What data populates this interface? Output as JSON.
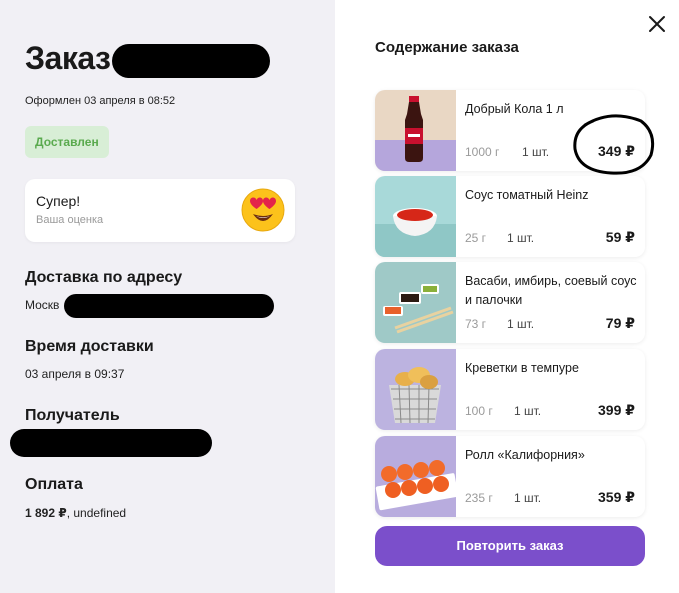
{
  "order": {
    "title": "Заказ",
    "date": "Оформлен 03 апреля в 08:52",
    "status": "Доставлен"
  },
  "rating": {
    "title": "Супер!",
    "subtitle": "Ваша оценка",
    "emoji_icon": "heart-eyes-emoji-icon"
  },
  "delivery": {
    "address_title": "Доставка по адресу",
    "address_value": "Москв",
    "time_title": "Время доставки",
    "time_value": "03 апреля в 09:37",
    "recipient_title": "Получатель",
    "payment_title": "Оплата",
    "payment_amount": "1 892 ₽",
    "payment_method": ", undefined"
  },
  "content": {
    "title": "Содержание заказа",
    "items": [
      {
        "name": "Добрый Кола 1 л",
        "weight": "1000 г",
        "qty": "1 шт.",
        "price": "349 ₽"
      },
      {
        "name": "Соус томатный Heinz",
        "weight": "25 г",
        "qty": "1 шт.",
        "price": "59 ₽"
      },
      {
        "name": "Васаби, имбирь, соевый соус и палочки",
        "weight": "73 г",
        "qty": "1 шт.",
        "price": "79 ₽"
      },
      {
        "name": "Креветки в темпуре",
        "weight": "100 г",
        "qty": "1 шт.",
        "price": "399 ₽"
      },
      {
        "name": "Ролл «Калифорния»",
        "weight": "235 г",
        "qty": "1 шт.",
        "price": "359 ₽"
      }
    ]
  },
  "actions": {
    "repeat_label": "Повторить заказ",
    "close_icon": "close-icon"
  },
  "colors": {
    "left_bg": "#f1f0f5",
    "status_bg": "#d8eed6",
    "status_text": "#5aaa4e",
    "accent": "#7b4fcb"
  }
}
